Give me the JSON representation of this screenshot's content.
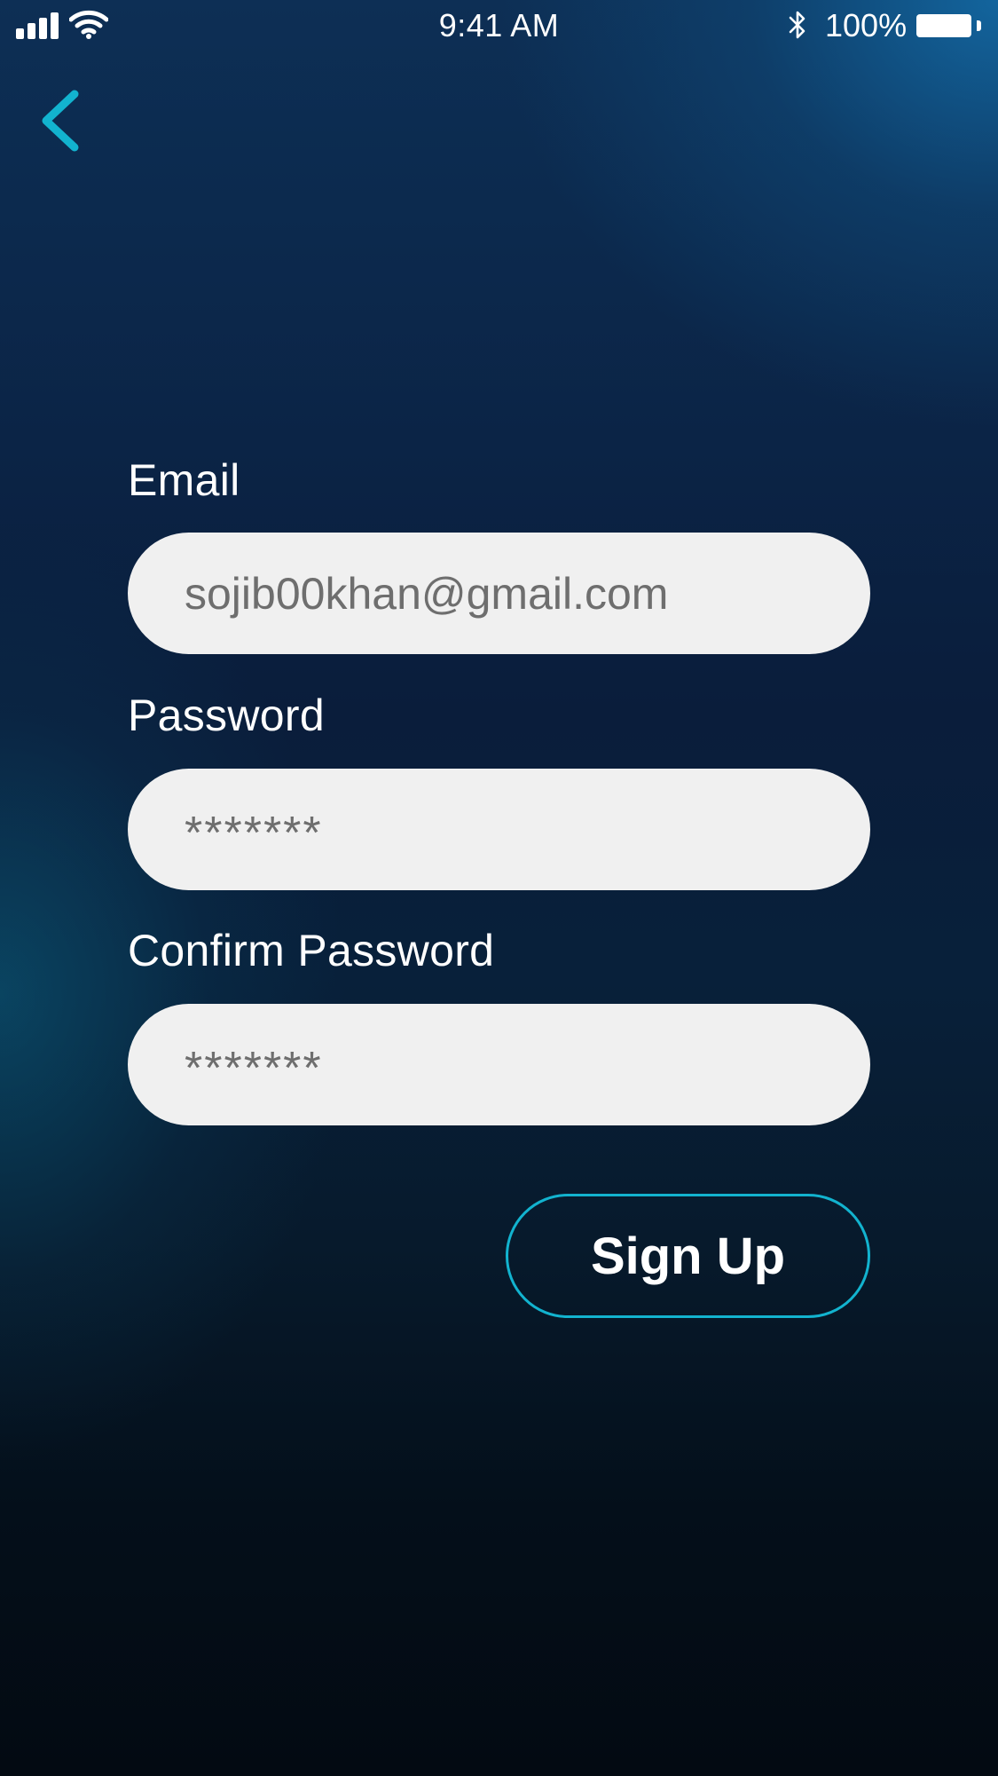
{
  "status_bar": {
    "time": "9:41 AM",
    "battery_percent": "100%",
    "icons": [
      "signal-icon",
      "wifi-icon",
      "bluetooth-icon",
      "battery-icon"
    ]
  },
  "nav": {
    "back_icon": "chevron-left-icon"
  },
  "form": {
    "email_label": "Email",
    "email_value": "sojib00khan@gmail.com",
    "password_label": "Password",
    "password_value": "*******",
    "confirm_label": "Confirm Password",
    "confirm_value": "*******",
    "submit_label": "Sign Up"
  },
  "colors": {
    "accent": "#12b3cf",
    "field_background": "#f0f0f0",
    "field_text": "#6e6e6e",
    "background_top": "#0d2f55",
    "background_bottom": "#030a12"
  }
}
